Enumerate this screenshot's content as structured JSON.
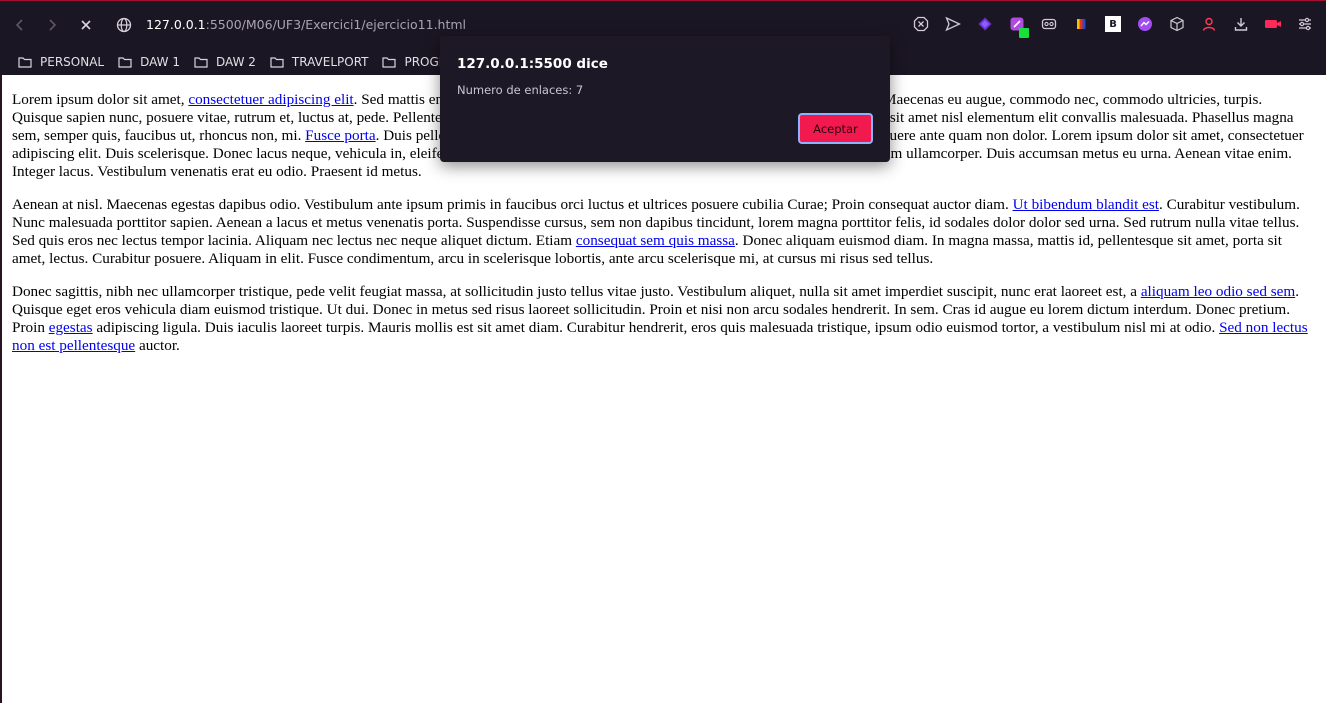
{
  "toolbar": {
    "url_host": "127.0.0.1",
    "url_path": ":5500/M06/UF3/Exercici1/ejercicio11.html",
    "icons": [
      "back-icon",
      "forward-icon",
      "loading-icon",
      "site-info-globe-icon",
      "ad-blocker-icon",
      "send-icon",
      "wallet-icon",
      "extension-puzzle-icon",
      "vpn-icon",
      "color-extension-icon",
      "b-extension-icon",
      "messenger-icon",
      "cube-icon",
      "profile-icon",
      "download-icon",
      "record-icon",
      "easy-setup-icon"
    ],
    "b_extension_label": "B"
  },
  "bookmarks": [
    {
      "label": "PERSONAL"
    },
    {
      "label": "DAW 1"
    },
    {
      "label": "DAW 2"
    },
    {
      "label": "TRAVELPORT"
    },
    {
      "label": "PROGRAM"
    }
  ],
  "page": {
    "p1": {
      "t1": "Lorem ipsum dolor sit amet, ",
      "a1": "consectetuer adipiscing elit",
      "t2": ". Sed mattis enim vel nisl. Curabitur at tellus. In orci. Suspendisse potenti. Nam ligula. Maecenas eu augue, commodo nec, commodo ultricies, turpis. Quisque sapien nunc, posuere vitae, rutrum et, luctus at, pede. Pellentesque massa ante, ornare id, aliquam vitae, ultrices porttitor, pede. Nullam sit amet nisl elementum elit convallis malesuada. Phasellus magna sem, semper quis, faucibus ut, rhoncus non, mi. ",
      "a2": "Fusce porta",
      "t3": ". Duis pellentesque, felis eu adipiscing ullamcorper, odio urna consequat arcu, at posuere ante quam non dolor. Lorem ipsum dolor sit amet, consectetuer adipiscing elit. Duis scelerisque. Donec lacus neque, vehicula in, eleifend vitae, venenatis ac, felis. Donec arcu. Nam sed tortor nec ipsum aliquam ullamcorper. Duis accumsan metus eu urna. Aenean vitae enim. Integer lacus. Vestibulum venenatis erat eu odio. Praesent id metus."
    },
    "p2": {
      "t1": "Aenean at nisl. Maecenas egestas dapibus odio. Vestibulum ante ipsum primis in faucibus orci luctus et ultrices posuere cubilia Curae; Proin consequat auctor diam. ",
      "a1": "Ut bibendum blandit est",
      "t2": ". Curabitur vestibulum. Nunc malesuada porttitor sapien. Aenean a lacus et metus venenatis porta. Suspendisse cursus, sem non dapibus tincidunt, lorem magna porttitor felis, id sodales dolor dolor sed urna. Sed rutrum nulla vitae tellus. Sed quis eros nec lectus tempor lacinia. Aliquam nec lectus nec neque aliquet dictum. Etiam ",
      "a2": "consequat sem quis massa",
      "t3": ". Donec aliquam euismod diam. In magna massa, mattis id, pellentesque sit amet, porta sit amet, lectus. Curabitur posuere. Aliquam in elit. Fusce condimentum, arcu in scelerisque lobortis, ante arcu scelerisque mi, at cursus mi risus sed tellus."
    },
    "p3": {
      "t1": "Donec sagittis, nibh nec ullamcorper tristique, pede velit feugiat massa, at sollicitudin justo tellus vitae justo. Vestibulum aliquet, nulla sit amet imperdiet suscipit, nunc erat laoreet est, a ",
      "a1": "aliquam leo odio sed sem",
      "t2": ". Quisque eget eros vehicula diam euismod tristique. Ut dui. Donec in metus sed risus laoreet sollicitudin. Proin et nisi non arcu sodales hendrerit. In sem. Cras id augue eu lorem dictum interdum. Donec pretium. Proin ",
      "a2": "egestas",
      "t3": " adipiscing ligula. Duis iaculis laoreet turpis. Mauris mollis est sit amet diam. Curabitur hendrerit, eros quis malesuada tristique, ipsum odio euismod tortor, a vestibulum nisl mi at odio. ",
      "a3": "Sed non lectus non est pellentesque",
      "t4": " auctor."
    }
  },
  "alert": {
    "title": "127.0.0.1:5500 dice",
    "message": "Numero de enlaces: 7",
    "button": "Aceptar"
  },
  "colors": {
    "toolbar_bg": "#1b1623",
    "accent_red": "#f2194e",
    "dialog_bg": "#1c1826",
    "link": "#0000ee"
  }
}
